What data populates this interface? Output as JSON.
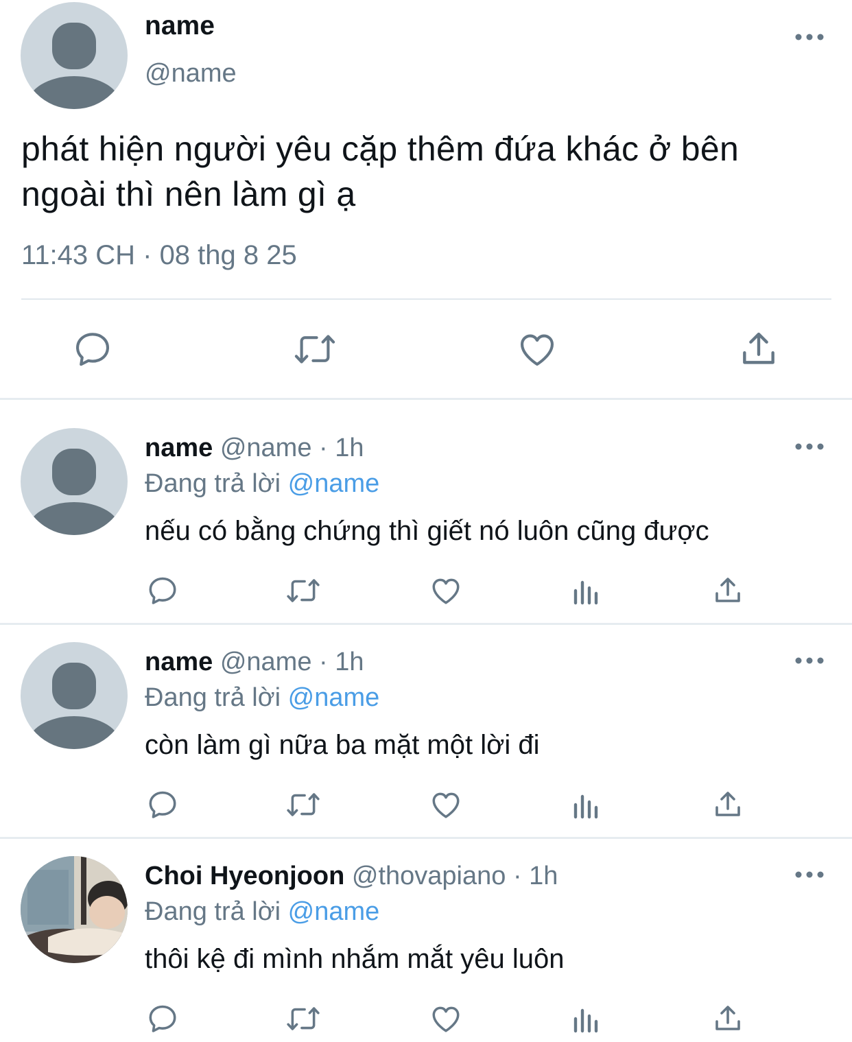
{
  "main_tweet": {
    "name": "name",
    "handle": "@name",
    "text": "phát hiện người yêu cặp thêm đứa khác ở bên ngoài thì nên làm gì ạ",
    "timestamp": "11:43 CH · 08 thg 8 25",
    "actions": [
      "reply-icon",
      "retweet-icon",
      "like-icon",
      "share-icon"
    ]
  },
  "replies": [
    {
      "name": "name",
      "handle": "@name",
      "separator": " · ",
      "time": "1h",
      "replying_prefix": "Đang trả lời ",
      "replying_to": "@name",
      "text": "nếu có bằng chứng thì giết nó luôn cũng được",
      "avatar": "default-avatar"
    },
    {
      "name": "name",
      "handle": "@name",
      "separator": " · ",
      "time": "1h",
      "replying_prefix": "Đang trả lời ",
      "replying_to": "@name",
      "text": "còn làm gì nữa ba mặt một lời đi",
      "avatar": "default-avatar"
    },
    {
      "name": "Choi Hyeonjoon",
      "handle": "@thovapiano",
      "separator": " · ",
      "time": "1h",
      "replying_prefix": "Đang trả lời ",
      "replying_to": "@name",
      "text": "thôi kệ đi mình nhắm mắt yêu luôn",
      "avatar": "photo-avatar"
    }
  ],
  "colors": {
    "text": "#0f1419",
    "secondary": "#657786",
    "mention": "#4a9de6",
    "divider": "#e6ecf0",
    "avatar_bg": "#ccd6dd",
    "avatar_fg": "#66757f"
  }
}
